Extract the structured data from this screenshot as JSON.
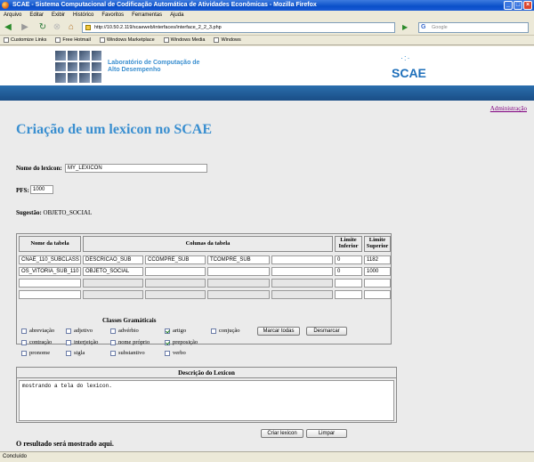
{
  "window": {
    "title": "SCAE - Sistema Computacional de Codificação Automática de Atividades Econômicas - Mozilla Firefox"
  },
  "menu": [
    "Arquivo",
    "Editar",
    "Exibir",
    "Histórico",
    "Favoritos",
    "Ferramentas",
    "Ajuda"
  ],
  "nav": {
    "url": "http://10.50.2.119/scaeweb/interfaces/interface_2_2_3.php",
    "search_placeholder": "Google"
  },
  "bookmarks": [
    "Customize Links",
    "Free Hotmail",
    "Windows Marketplace",
    "Windows Media",
    "Windows"
  ],
  "banner": {
    "lab_line1": "Laboratório de Computação de",
    "lab_line2": "Alto Desempenho",
    "logo_text": "SCAE"
  },
  "admin_link": "Administração",
  "page_title": "Criação de um lexicon no SCAE",
  "form": {
    "lexicon_label": "Nome do lexicon:",
    "lexicon_value": "MY_LEXICON",
    "pfs_label": "PFS:",
    "pfs_value": "1000",
    "suggestion_label": "Sugestão:",
    "suggestion_value": "OBJETO_SOCIAL"
  },
  "table": {
    "headers": {
      "table_name": "Nome da tabela",
      "columns": "Colunas da tabela",
      "lower_limit_1": "Limite",
      "lower_limit_2": "Inferior",
      "upper_limit_1": "Limite",
      "upper_limit_2": "Superior"
    },
    "rows": [
      {
        "name": "CNAE_110_SUBCLASS",
        "c1": "DESCRICAO_SUB",
        "c2": "CCOMPRE_SUB",
        "c3": "TCOMPRE_SUB",
        "c4": "",
        "lower": "0",
        "upper": "1182"
      },
      {
        "name": "OS_VITORIA_SUB_110",
        "c1": "OBJETO_SOCIAL",
        "c2": "",
        "c3": "",
        "c4": "",
        "lower": "0",
        "upper": "1000"
      },
      {
        "name": "",
        "c1": "",
        "c2": "",
        "c3": "",
        "c4": "",
        "lower": "",
        "upper": ""
      },
      {
        "name": "",
        "c1": "",
        "c2": "",
        "c3": "",
        "c4": "",
        "lower": "",
        "upper": ""
      }
    ]
  },
  "classes": {
    "title": "Classes Gramáticais",
    "items": [
      {
        "label": "abreviação",
        "checked": false
      },
      {
        "label": "adjetivo",
        "checked": false
      },
      {
        "label": "advérbio",
        "checked": false
      },
      {
        "label": "artigo",
        "checked": true
      },
      {
        "label": "conjução",
        "checked": false
      },
      {
        "label": "contração",
        "checked": false
      },
      {
        "label": "interjeição",
        "checked": false
      },
      {
        "label": "nome próprio",
        "checked": false
      },
      {
        "label": "preposição",
        "checked": true
      },
      {
        "label": "pronome",
        "checked": false
      },
      {
        "label": "sigla",
        "checked": false
      },
      {
        "label": "substantivo",
        "checked": false
      },
      {
        "label": "verbo",
        "checked": false
      }
    ],
    "mark_all": "Marcar todas",
    "unmark": "Desmarcar"
  },
  "description": {
    "title": "Descrição do Lexicon",
    "value": "mostrando a tela do lexicon."
  },
  "actions": {
    "create": "Criar lexicon",
    "clear": "Limpar"
  },
  "result_text": "O resultado será mostrado aqui.",
  "status": "Concluído"
}
